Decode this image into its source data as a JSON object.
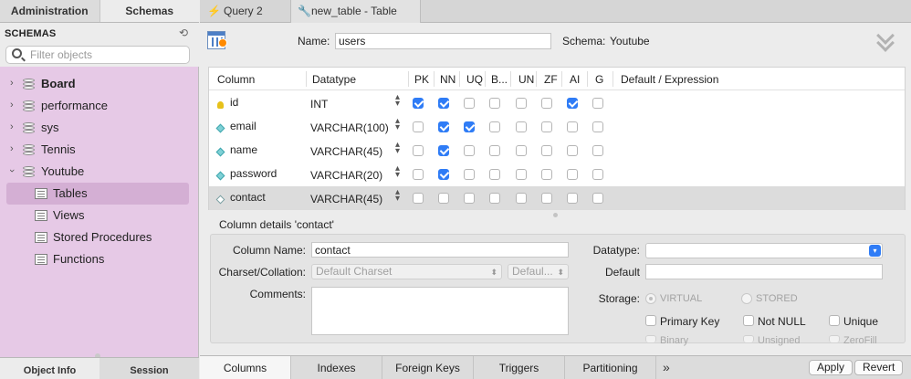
{
  "sidebar": {
    "tabs": [
      "Administration",
      "Schemas"
    ],
    "title": "SCHEMAS",
    "filter_placeholder": "Filter objects",
    "tree": [
      {
        "label": "Board",
        "bold": true,
        "expanded": false
      },
      {
        "label": "performance",
        "bold": false,
        "expanded": false
      },
      {
        "label": "sys",
        "bold": false,
        "expanded": false
      },
      {
        "label": "Tennis",
        "bold": false,
        "expanded": false
      },
      {
        "label": "Youtube",
        "bold": false,
        "expanded": true
      }
    ],
    "children": [
      "Tables",
      "Views",
      "Stored Procedures",
      "Functions"
    ],
    "selected_child": "Tables",
    "bottom_tabs": [
      "Object Info",
      "Session"
    ]
  },
  "doc_tabs": [
    {
      "label": "Query 2",
      "icon": "lightning-icon"
    },
    {
      "label": "new_table - Table",
      "icon": "wrench-icon"
    }
  ],
  "header": {
    "name_label": "Name:",
    "name_value": "users",
    "schema_label": "Schema:",
    "schema_value": "Youtube"
  },
  "grid": {
    "headers": [
      "Column",
      "Datatype",
      "PK",
      "NN",
      "UQ",
      "B...",
      "UN",
      "ZF",
      "AI",
      "G",
      "Default / Expression"
    ],
    "rows": [
      {
        "name": "id",
        "type": "INT",
        "icon": "key-icon",
        "flags": [
          true,
          true,
          false,
          false,
          false,
          false,
          true,
          false
        ]
      },
      {
        "name": "email",
        "type": "VARCHAR(100)",
        "icon": "column-icon",
        "flags": [
          false,
          true,
          true,
          false,
          false,
          false,
          false,
          false
        ]
      },
      {
        "name": "name",
        "type": "VARCHAR(45)",
        "icon": "column-icon",
        "flags": [
          false,
          true,
          false,
          false,
          false,
          false,
          false,
          false
        ]
      },
      {
        "name": "password",
        "type": "VARCHAR(20)",
        "icon": "column-icon",
        "flags": [
          false,
          true,
          false,
          false,
          false,
          false,
          false,
          false
        ]
      },
      {
        "name": "contact",
        "type": "VARCHAR(45)",
        "icon": "column-hollow-icon",
        "flags": [
          false,
          false,
          false,
          false,
          false,
          false,
          false,
          false
        ]
      }
    ]
  },
  "details": {
    "title": "Column details 'contact'",
    "column_name_label": "Column Name:",
    "column_name_value": "contact",
    "charset_label": "Charset/Collation:",
    "charset_value": "Default Charset",
    "collation_value": "Defaul...",
    "comments_label": "Comments:",
    "datatype_label": "Datatype:",
    "default_label": "Default",
    "storage_label": "Storage:",
    "virtual_label": "VIRTUAL",
    "stored_label": "STORED",
    "primary_key_label": "Primary Key",
    "not_null_label": "Not NULL",
    "unique_label": "Unique",
    "binary_label": "Binary",
    "unsigned_label": "Unsigned",
    "zerofill_label": "ZeroFill"
  },
  "bottom_tabs": [
    "Columns",
    "Indexes",
    "Foreign Keys",
    "Triggers",
    "Partitioning"
  ],
  "buttons": {
    "apply": "Apply",
    "revert": "Revert"
  }
}
